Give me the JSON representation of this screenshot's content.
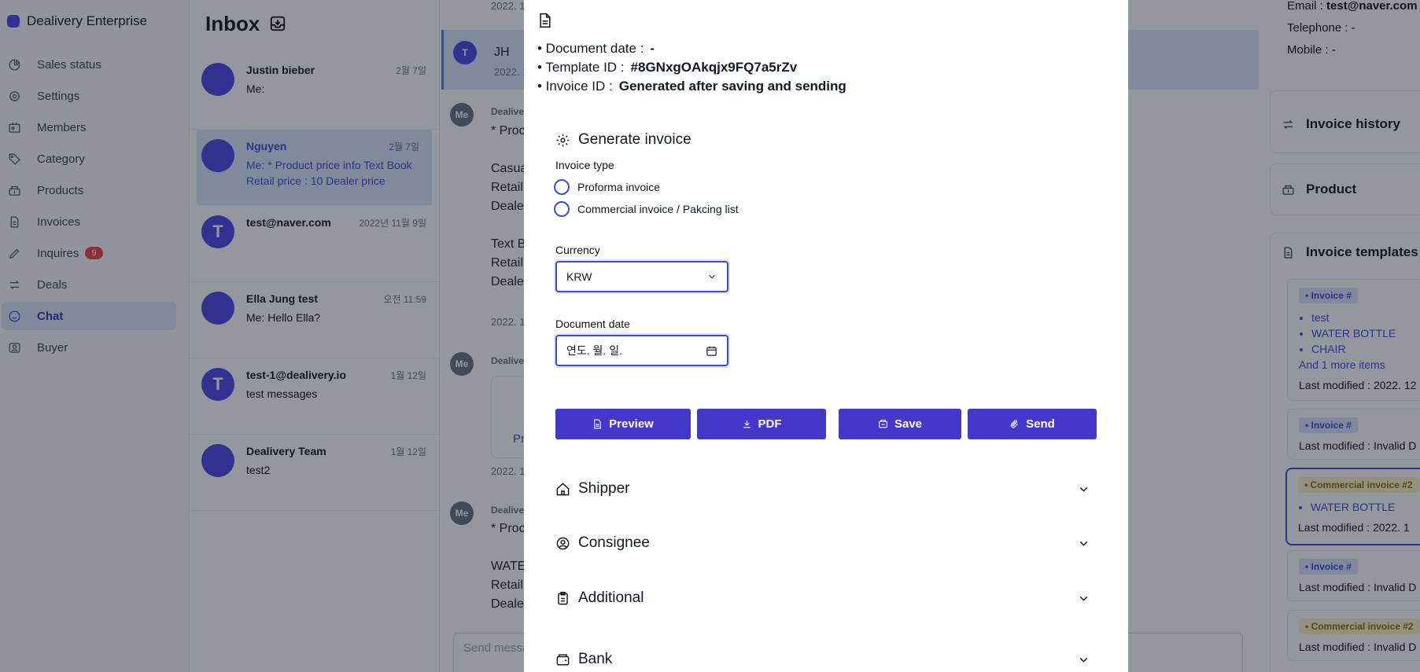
{
  "sidebar": {
    "brand": "Dealivery Enterprise",
    "items": [
      {
        "label": "Sales status",
        "icon": "pie-chart-icon"
      },
      {
        "label": "Settings",
        "icon": "gear-icon"
      },
      {
        "label": "Members",
        "icon": "id-card-icon"
      },
      {
        "label": "Category",
        "icon": "tag-icon"
      },
      {
        "label": "Products",
        "icon": "box-icon"
      },
      {
        "label": "Invoices",
        "icon": "document-icon"
      },
      {
        "label": "Inquires",
        "icon": "pencil-icon",
        "badge": "9"
      },
      {
        "label": "Deals",
        "icon": "swap-icon"
      },
      {
        "label": "Chat",
        "icon": "smile-icon",
        "active": true
      },
      {
        "label": "Buyer",
        "icon": "user-icon"
      }
    ]
  },
  "inbox": {
    "title": "Inbox",
    "conversations": [
      {
        "name": "Justin bieber",
        "time": "2월 7일",
        "preview": "Me:",
        "avatar": ""
      },
      {
        "name": "Nguyen",
        "time": "2월 7일",
        "preview": "Me: * Product price info Text Book Retail price : 10 Dealer price",
        "avatar": "",
        "active": true
      },
      {
        "name": "test@naver.com",
        "time": "2022년 11월 9일",
        "preview": "",
        "avatar": "T"
      },
      {
        "name": "Ella Jung test",
        "time": "오전 11:59",
        "preview": "Me: Hello Ella?",
        "avatar": ""
      },
      {
        "name": "test-1@dealivery.io",
        "time": "1월 12일",
        "preview": "test messages",
        "avatar": "T"
      },
      {
        "name": "Dealivery Team",
        "time": "1월 12일",
        "preview": "test2",
        "avatar": ""
      }
    ]
  },
  "chat": {
    "header_avatar": "T",
    "header_name": "JH",
    "date_top": "2022. 1",
    "date_header": "2022. 1",
    "me_label": "Me",
    "sender_fragment": "Dealive",
    "msg1_lines": [
      "* Proc",
      "",
      "Casua",
      "Retail",
      "Deale",
      "",
      "Text B",
      "Retail",
      "Deale"
    ],
    "msg1_date": "2022. 1",
    "msg2_link": "Pr",
    "msg2_date": "2022. 1",
    "msg3_lines": [
      "* Proc",
      "",
      "WATE",
      "Retail",
      "Deale"
    ],
    "input_placeholder": "Send messa"
  },
  "right_panel": {
    "email_label": "Email :",
    "email_value": "test@naver.com",
    "telephone": "Telephone : -",
    "mobile": "Mobile : -",
    "invoice_history": "Invoice history",
    "product": "Product",
    "invoice_templates": "Invoice templates",
    "templates": [
      {
        "tag": "• Invoice #",
        "tag_color": "blue",
        "items": [
          "test",
          "WATER BOTTLE",
          "CHAIR"
        ],
        "more": "And 1 more items",
        "modified": "Last modified : 2022. 12"
      },
      {
        "tag": "• Invoice #",
        "tag_color": "blue",
        "items": [],
        "more": "",
        "modified": "Last modified : Invalid D"
      },
      {
        "tag": "• Commercial invoice #2",
        "tag_color": "yellow",
        "items": [
          "WATER BOTTLE"
        ],
        "more": "",
        "modified": "Last modified : 2022. 1",
        "selected": true
      },
      {
        "tag": "• Invoice #",
        "tag_color": "blue",
        "items": [],
        "more": "",
        "modified": "Last modified : Invalid D"
      },
      {
        "tag": "• Commercial invoice #2",
        "tag_color": "yellow",
        "items": [],
        "more": "",
        "modified": "Last modified : Invalid D"
      }
    ]
  },
  "modal": {
    "document_date_label": "• Document date :",
    "document_date_value": "-",
    "template_id_label": "• Template ID :",
    "template_id_value": "#8GNxgOAkqjx9FQ7a5rZv",
    "invoice_id_label": "• Invoice ID :",
    "invoice_id_value": "Generated after saving and sending",
    "generate_title": "Generate invoice",
    "invoice_type_label": "Invoice type",
    "invoice_type_options": [
      "Proforma invoice",
      "Commercial invoice / Pakcing list"
    ],
    "currency_label": "Currency",
    "currency_value": "KRW",
    "document_date_field_label": "Document date",
    "document_date_placeholder": "연도. 월. 일.",
    "buttons": {
      "preview": "Preview",
      "pdf": "PDF",
      "save": "Save",
      "send": "Send"
    },
    "sections": [
      "Shipper",
      "Consignee",
      "Additional",
      "Bank"
    ]
  },
  "colors": {
    "accent": "#4338ca",
    "overlay": "rgba(17,24,39,0.45)",
    "badge": "#ef4444"
  }
}
